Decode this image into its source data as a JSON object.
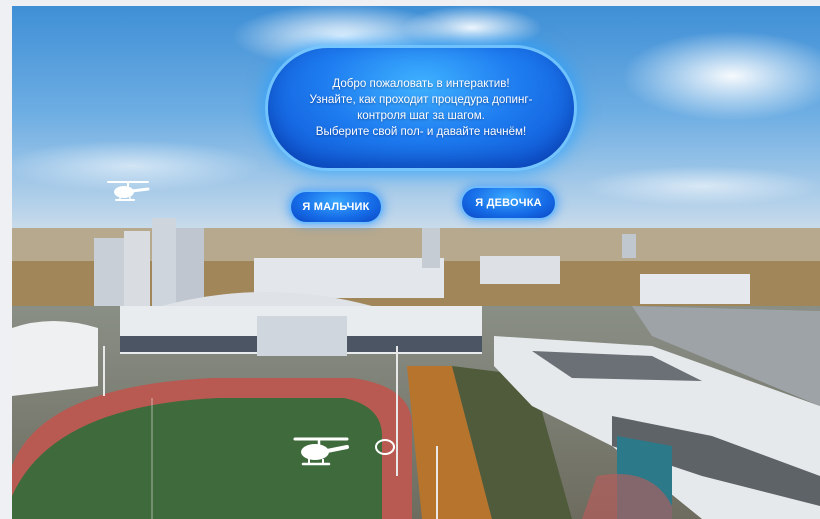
{
  "welcome": {
    "lines": [
      "Добро пожаловать в интерактив!",
      "Узнайте, как проходит процедура допинг-",
      "контроля шаг за шагом.",
      "Выберите свой пол- и давайте начнём!"
    ]
  },
  "buttons": {
    "boy": "Я МАЛЬЧИК",
    "girl": "Я ДЕВОЧКА"
  },
  "colors": {
    "bubble": "#1e7cf0",
    "bubble_glow": "#3fb2ff",
    "button": "#156ae6"
  },
  "hotspots": [
    "helicopter-icon",
    "helicopter-icon",
    "ring-marker-icon"
  ]
}
